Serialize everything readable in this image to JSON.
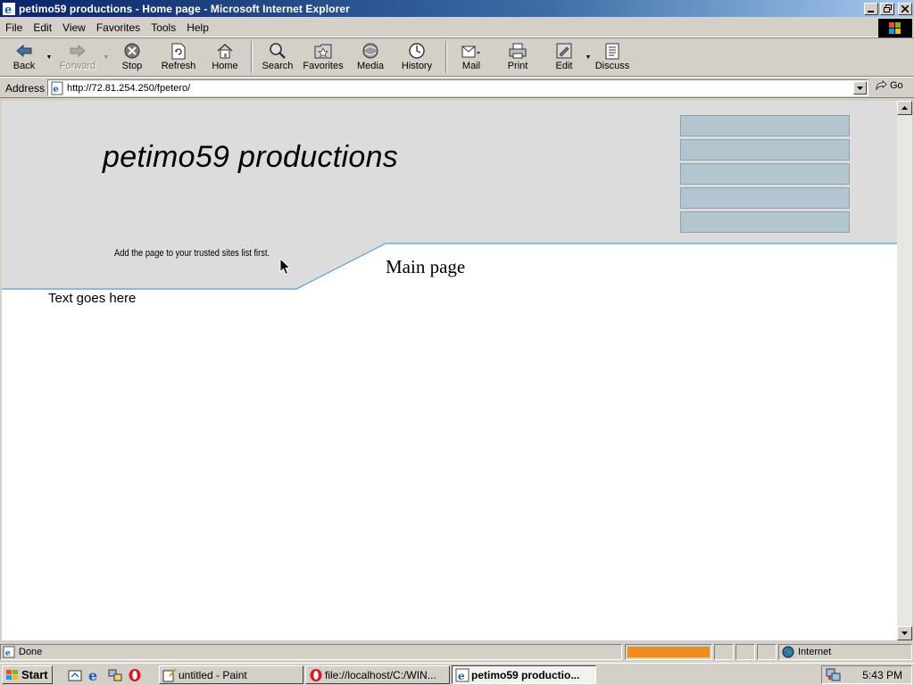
{
  "window": {
    "title": "petimo59 productions - Home page - Microsoft Internet Explorer"
  },
  "menu": [
    {
      "label": "File"
    },
    {
      "label": "Edit"
    },
    {
      "label": "View"
    },
    {
      "label": "Favorites"
    },
    {
      "label": "Tools"
    },
    {
      "label": "Help"
    }
  ],
  "toolbar": {
    "back": "Back",
    "forward": "Forward",
    "stop": "Stop",
    "refresh": "Refresh",
    "home": "Home",
    "search": "Search",
    "favorites": "Favorites",
    "media": "Media",
    "history": "History",
    "mail": "Mail",
    "print": "Print",
    "edit": "Edit",
    "discuss": "Discuss"
  },
  "address": {
    "label": "Address",
    "url": "http://72.81.254.250/fpetero/",
    "go": "Go"
  },
  "page": {
    "site_title": "petimo59 productions",
    "notice": "Add the page to your trusted sites list first.",
    "heading": "Main page",
    "body_text": "Text goes here",
    "nav_boxes": [
      "",
      "",
      "",
      "",
      ""
    ],
    "colors": {
      "banner": "#dcdcdc",
      "nav_box": "#b3c6d0",
      "divider": "#5aa0d0"
    }
  },
  "status": {
    "text": "Done",
    "zone": "Internet",
    "progress_color": "#f08c1c"
  },
  "taskbar": {
    "start": "Start",
    "tasks": [
      {
        "label": "untitled - Paint"
      },
      {
        "label": "file://localhost/C:/WIN..."
      },
      {
        "label": "petimo59 productio..."
      }
    ],
    "clock": "5:43 PM"
  }
}
